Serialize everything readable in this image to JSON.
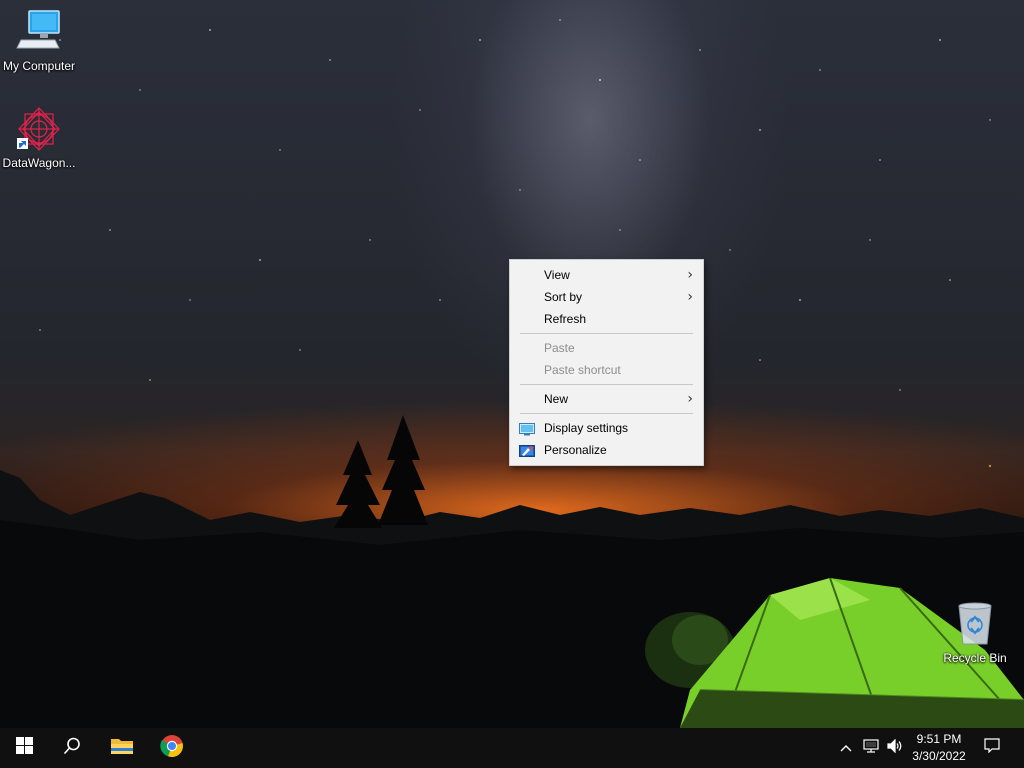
{
  "desktop": {
    "icons": [
      {
        "label": "My Computer",
        "icon": "computer-icon"
      },
      {
        "label": "DataWagon...",
        "icon": "datawagon-icon"
      },
      {
        "label": "Recycle Bin",
        "icon": "recycle-bin-icon"
      }
    ]
  },
  "context_menu": {
    "items": [
      {
        "label": "View",
        "has_submenu": true
      },
      {
        "label": "Sort by",
        "has_submenu": true
      },
      {
        "label": "Refresh"
      },
      {
        "label": "Paste",
        "disabled": true
      },
      {
        "label": "Paste shortcut",
        "disabled": true
      },
      {
        "label": "New",
        "has_submenu": true
      },
      {
        "label": "Display settings",
        "icon": "display-icon"
      },
      {
        "label": "Personalize",
        "icon": "personalize-icon"
      }
    ],
    "submenu_arrow": "›"
  },
  "taskbar": {
    "buttons": [
      {
        "icon": "windows-start-icon"
      },
      {
        "icon": "search-icon"
      },
      {
        "icon": "file-explorer-icon"
      },
      {
        "icon": "chrome-icon"
      }
    ],
    "tray": {
      "chevron": "chevron-up-icon",
      "network": "network-icon",
      "volume": "volume-icon",
      "notifications": "notification-icon"
    },
    "clock": {
      "time": "9:51 PM",
      "date": "3/30/2022"
    }
  },
  "colors": {
    "menu_bg": "#f2f2f2",
    "menu_disabled": "#8d8d8d",
    "taskbar_bg": "#101010",
    "tent": "#7bd42a",
    "horizon_glow": "#eb6e1e"
  }
}
